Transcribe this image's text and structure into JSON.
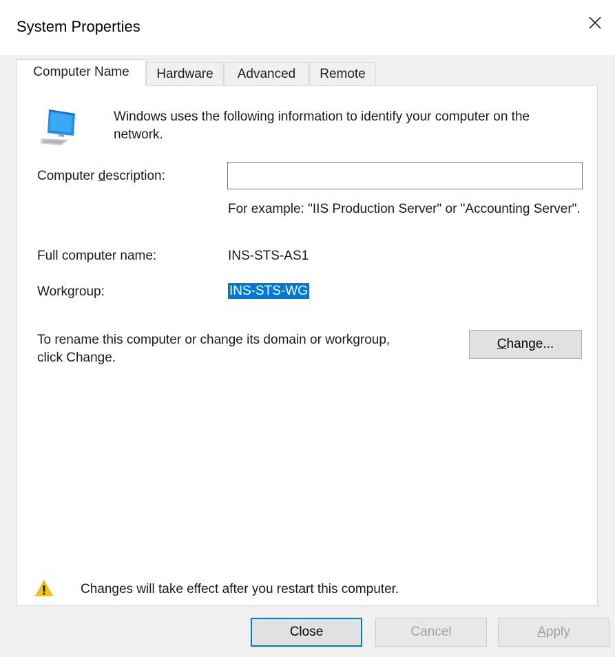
{
  "window": {
    "title": "System Properties"
  },
  "tabs": [
    {
      "label": "Computer Name",
      "active": true
    },
    {
      "label": "Hardware",
      "active": false
    },
    {
      "label": "Advanced",
      "active": false
    },
    {
      "label": "Remote",
      "active": false
    }
  ],
  "panel": {
    "info_text": "Windows uses the following information to identify your computer on the network.",
    "description_label_pre": "Computer ",
    "description_label_underlined": "d",
    "description_label_post": "escription:",
    "description_value": "",
    "description_example": "For example: \"IIS Production Server\" or \"Accounting Server\".",
    "full_name_label": "Full computer name:",
    "full_name_value": "INS-STS-AS1",
    "workgroup_label": "Workgroup:",
    "workgroup_value": "INS-STS-WG",
    "rename_text": "To rename this computer or change its domain or workgroup, click Change.",
    "change_button_underlined": "C",
    "change_button_rest": "hange...",
    "warning_text": "Changes will take effect after you restart this computer."
  },
  "footer": {
    "close_label": "Close",
    "cancel_label": "Cancel",
    "apply_label_underlined": "A",
    "apply_label_rest": "pply"
  },
  "colors": {
    "selection": "#0078d7",
    "default_button_border": "#0078d7",
    "warning_yellow": "#f7c600"
  },
  "icons": {
    "close": "close-icon",
    "computer": "computer-icon",
    "warning": "warning-icon"
  }
}
